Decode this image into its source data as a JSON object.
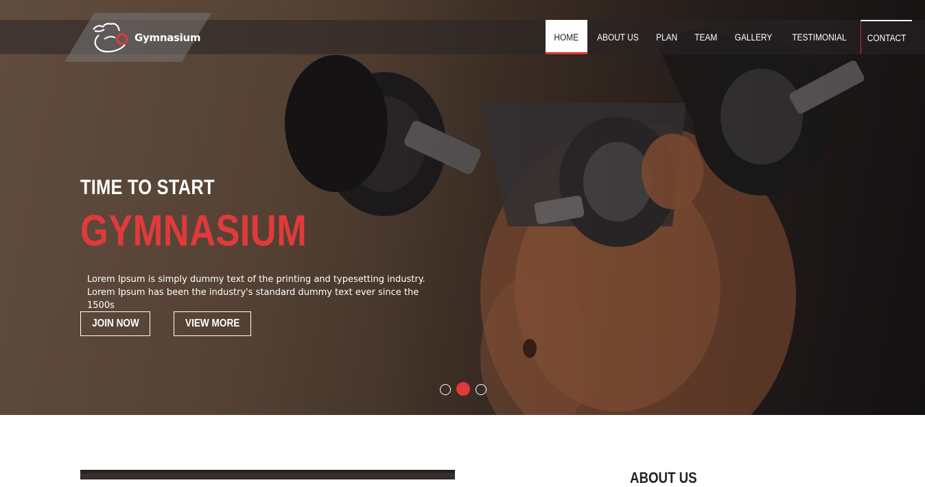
{
  "brand": {
    "name": "Gymnasium",
    "logo_icon": "flexed-arm-icon",
    "accent_color": "#e03a3a"
  },
  "nav": {
    "items": [
      {
        "label": "HOME",
        "active": true
      },
      {
        "label": "ABOUT US",
        "active": false
      },
      {
        "label": "PLAN",
        "active": false
      },
      {
        "label": "TEAM",
        "active": false
      },
      {
        "label": "GALLERY",
        "active": false
      },
      {
        "label": "TESTIMONIAL",
        "active": false
      },
      {
        "label": "CONTACT",
        "active": false
      }
    ]
  },
  "hero": {
    "eyebrow": "TIME TO START",
    "headline": "GYMNASIUM",
    "description": "Lorem Ipsum is simply dummy text of the printing and typesetting industry. Lorem Ipsum has been the industry's standard dummy text ever since the 1500s",
    "join_label": "JOIN NOW",
    "more_label": "VIEW MORE",
    "slides_total": 3,
    "active_slide": 2
  },
  "about": {
    "heading": "ABOUT US"
  }
}
